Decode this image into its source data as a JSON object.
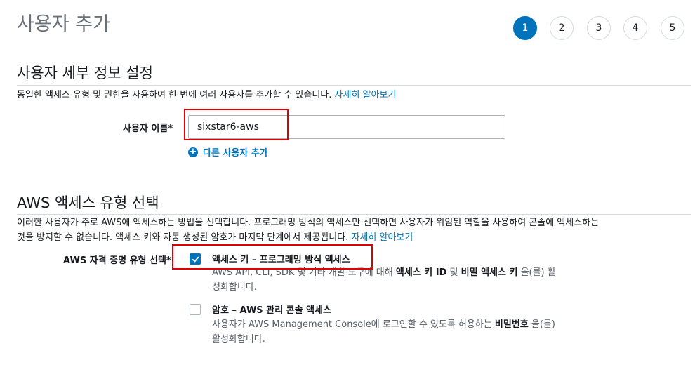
{
  "page": {
    "title": "사용자 추가"
  },
  "steps": [
    {
      "label": "1",
      "active": true
    },
    {
      "label": "2",
      "active": false
    },
    {
      "label": "3",
      "active": false
    },
    {
      "label": "4",
      "active": false
    },
    {
      "label": "5",
      "active": false
    }
  ],
  "user_details": {
    "heading": "사용자 세부 정보 설정",
    "description": "동일한 액세스 유형 및 권한을 사용하여 한 번에 여러 사용자를 추가할 수 있습니다.",
    "learn_more": "자세히 알아보기",
    "username_label": "사용자 이름*",
    "username_value": "sixstar6-aws",
    "add_user_label": "다른 사용자 추가"
  },
  "access_type": {
    "heading": "AWS 액세스 유형 선택",
    "description_line1": "이러한 사용자가 주로 AWS에 액세스하는 방법을 선택합니다. 프로그래밍 방식의 액세스만 선택하면 사용자가 위임된 역할을 사용하여 콘솔에 액세스하는",
    "description_line2": "것을 방지할 수 없습니다. 액세스 키와 자동 생성된 암호가 마지막 단계에서 제공됩니다.",
    "learn_more": "자세히 알아보기",
    "credential_label": "AWS 자격 증명 유형 선택*",
    "options": [
      {
        "title": "액세스 키 – 프로그래밍 방식 액세스",
        "checked": true,
        "desc_line1_prefix": "AWS API, CLI, SDK 및 기타 개발 도구에 대해 ",
        "desc_bold1": "액세스 키 ID",
        "desc_mid": " 및 ",
        "desc_bold2": "비밀 액세스 키",
        "desc_line1_suffix": " 을(를) 활",
        "desc_line2": "성화합니다."
      },
      {
        "title": "암호 – AWS 관리 콘솔 액세스",
        "checked": false,
        "desc_line1_prefix": "사용자가 AWS Management Console에 로그인할 수 있도록 허용하는 ",
        "desc_bold1": "비밀번호",
        "desc_line1_suffix": " 을(를)",
        "desc_line2": "활성화합니다."
      }
    ]
  },
  "colors": {
    "primary": "#0073bb",
    "highlight": "#e00000",
    "muted": "#687078"
  }
}
